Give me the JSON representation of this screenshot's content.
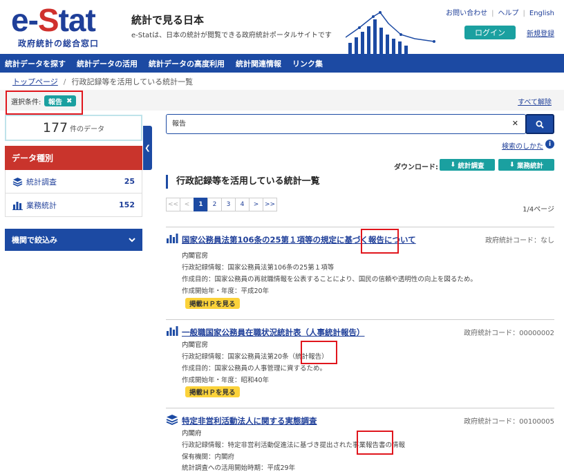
{
  "header": {
    "logo_main_pre": "e-",
    "logo_main_s": "S",
    "logo_main_post": "tat",
    "logo_sub": "政府統計の総合窓口",
    "title": "統計で見る日本",
    "description": "e-Statは、日本の統計が閲覧できる政府統計ポータルサイトです",
    "links": [
      "お問い合わせ",
      "ヘルプ",
      "English"
    ],
    "login_label": "ログイン",
    "signup_label": "新規登録"
  },
  "nav": {
    "items": [
      "統計データを探す",
      "統計データの活用",
      "統計データの高度利用",
      "統計関連情報",
      "リンク集"
    ]
  },
  "breadcrumb": {
    "home": "トップページ",
    "current": "行政記録等を活用している統計一覧"
  },
  "conditions": {
    "label": "選択条件:",
    "chip": "報告",
    "clear_all": "すべて解除"
  },
  "sidebar": {
    "count": "177",
    "count_unit": "件のデータ",
    "type_heading": "データ種別",
    "types": [
      {
        "label": "統計調査",
        "count": "25"
      },
      {
        "label": "業務統計",
        "count": "152"
      }
    ],
    "org_filter": "機関で絞込み"
  },
  "search": {
    "value": "報告",
    "help_label": "検索のしかた"
  },
  "download": {
    "label": "ダウンロード:",
    "buttons": [
      "統計調査",
      "業務統計"
    ]
  },
  "list": {
    "title": "行政記録等を活用している統計一覧",
    "page_info": "1/4ページ",
    "pager": [
      "<<",
      "<",
      "1",
      "2",
      "3",
      "4",
      ">",
      ">>"
    ]
  },
  "results": [
    {
      "icon": "bar-chart-icon",
      "title": "国家公務員法第106条の25第１項等の規定に基づく報告について",
      "code": "政府統計コード：なし",
      "org": "内閣官房",
      "lines": [
        "行政記録情報：国家公務員法第106条の25第１項等",
        "作成目的：国家公務員の再就職情報を公表することにより、国民の信頼や透明性の向上を図るため。",
        "作成開始年・年度：平成20年"
      ],
      "hp": "掲載ＨＰを見る"
    },
    {
      "icon": "bar-chart-icon",
      "title": "一般職国家公務員在職状況統計表（人事統計報告）",
      "code": "政府統計コード：00000002",
      "org": "内閣官房",
      "lines": [
        "行政記録情報：国家公務員法第20条（統計報告）",
        "作成目的：国家公務員の人事管理に資するため。",
        "作成開始年・年度：昭和40年"
      ],
      "hp": "掲載ＨＰを見る"
    },
    {
      "icon": "stack-icon",
      "title": "特定非営利活動法人に関する実態調査",
      "code": "政府統計コード：00100005",
      "org": "内閣府",
      "lines": [
        "行政記録情報：特定非営利活動促進法に基づき提出された事業報告書の情報",
        "保有機関：内閣府",
        "統計調査への活用開始時期：平成29年"
      ]
    }
  ]
}
